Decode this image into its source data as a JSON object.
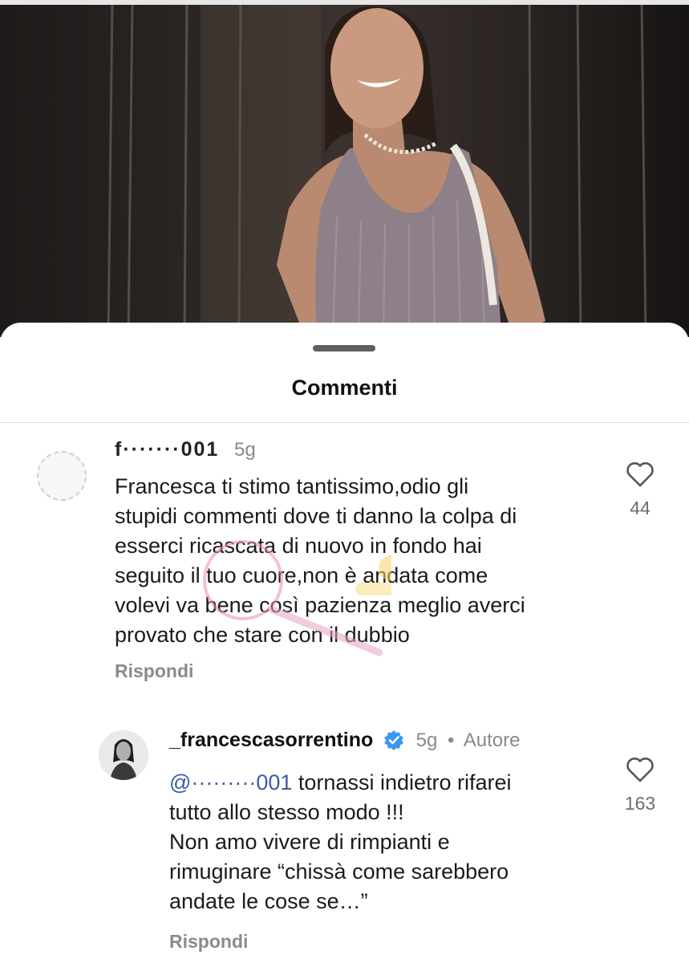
{
  "sheet": {
    "title": "Commenti"
  },
  "comments": [
    {
      "username": "f·······001",
      "time": "5g",
      "text": "Francesca ti stimo tantissimo,odio gli\nstupidi commenti dove ti danno la colpa di\nesserci ricascata di nuovo in fondo hai\nseguito il tuo cuore,non è andata come\nvolevi va bene così pazienza meglio averci\nprovato che stare con il dubbio",
      "reply_label": "Rispondi",
      "likes": "44"
    },
    {
      "username": "_francescasorrentino",
      "verified": true,
      "time": "5g",
      "author_badge": "Autore",
      "mention": "@·········001",
      "text_first_line": "tornassi indietro rifarei",
      "text": "tutto allo stesso modo !!!\nNon amo vivere di rimpianti e\nrimuginare “chissà come sarebbero\nandate le cose se…”",
      "reply_label": "Rispondi",
      "likes": "163"
    }
  ],
  "colors": {
    "verified": "#3897f0",
    "secondary_text": "#8a8a8a",
    "mention": "#3b5ba5"
  },
  "icons": [
    "heart-icon",
    "verified-badge-icon"
  ]
}
